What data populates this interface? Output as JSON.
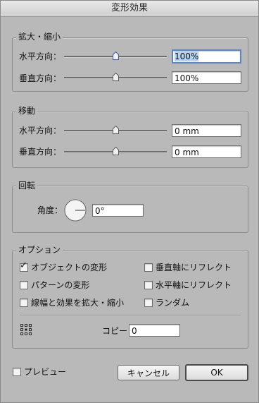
{
  "window": {
    "title": "変形効果"
  },
  "scale": {
    "title": "拡大・縮小",
    "horizontal_label": "水平方向：",
    "horizontal_value": "100%",
    "horizontal_slider": 0.5,
    "vertical_label": "垂直方向：",
    "vertical_value": "100%",
    "vertical_slider": 0.5
  },
  "move": {
    "title": "移動",
    "horizontal_label": "水平方向：",
    "horizontal_value": "0 mm",
    "horizontal_slider": 0.5,
    "vertical_label": "垂直方向：",
    "vertical_value": "0 mm",
    "vertical_slider": 0.5
  },
  "rotate": {
    "title": "回転",
    "angle_label": "角度：",
    "angle_value": "0°"
  },
  "options": {
    "title": "オプション",
    "checkboxes": [
      {
        "label": "オブジェクトの変形",
        "checked": true
      },
      {
        "label": "垂直軸にリフレクト",
        "checked": false
      },
      {
        "label": "パターンの変形",
        "checked": false
      },
      {
        "label": "水平軸にリフレクト",
        "checked": false
      },
      {
        "label": "線幅と効果を拡大・縮小",
        "checked": false
      },
      {
        "label": "ランダム",
        "checked": false
      }
    ],
    "copies_label": "コピー",
    "copies_value": "0"
  },
  "footer": {
    "preview_label": "プレビュー",
    "preview_checked": false,
    "cancel_label": "キャンセル",
    "ok_label": "OK"
  },
  "icons": {
    "checkmark": "✓",
    "reference_point": "reference-point-icon",
    "angle_dial": "angle-dial-icon"
  },
  "colors": {
    "focus_ring": "#5b86c4",
    "selection": "#b5d3f3",
    "focused_thumb": "#3f63a7"
  }
}
